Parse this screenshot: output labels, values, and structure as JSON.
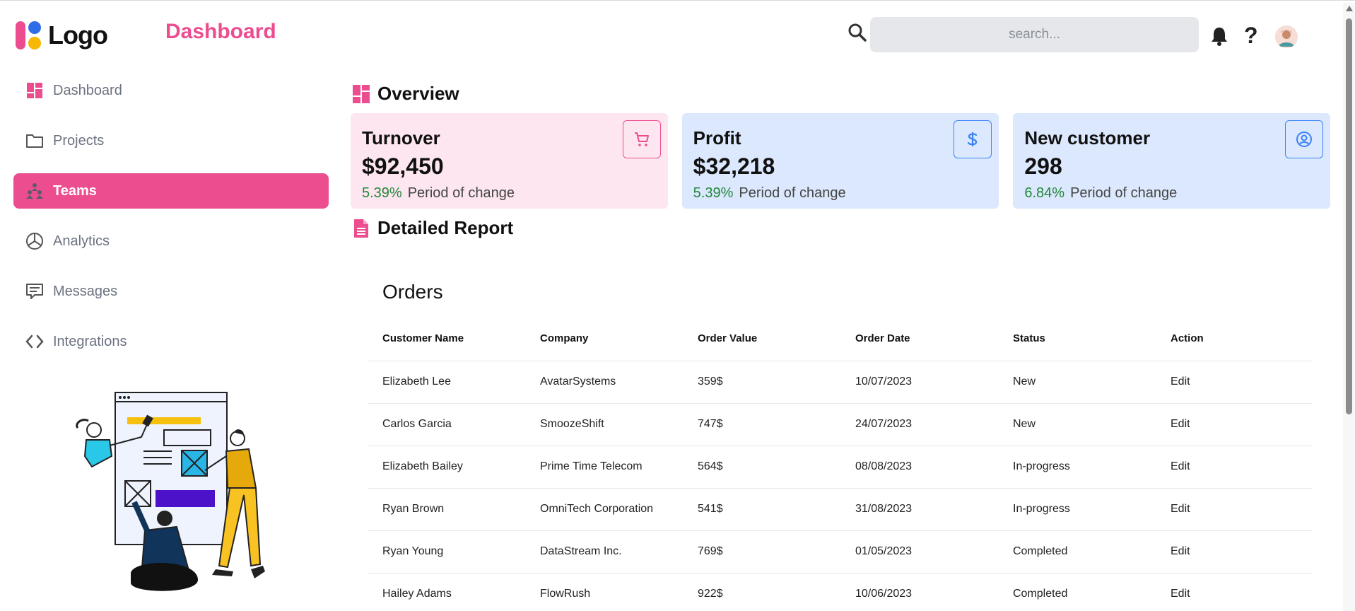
{
  "header": {
    "logo_text": "Logo",
    "page_title": "Dashboard",
    "search_placeholder": "search...",
    "help_label": "?"
  },
  "sidebar": {
    "items": [
      {
        "label": "Dashboard",
        "icon": "dashboard-grid-icon",
        "active": false
      },
      {
        "label": "Projects",
        "icon": "folder-icon",
        "active": false
      },
      {
        "label": "Teams",
        "icon": "team-icon",
        "active": true
      },
      {
        "label": "Analytics",
        "icon": "pie-chart-icon",
        "active": false
      },
      {
        "label": "Messages",
        "icon": "message-icon",
        "active": false
      },
      {
        "label": "Integrations",
        "icon": "code-icon",
        "active": false
      }
    ]
  },
  "overview": {
    "title": "Overview",
    "cards": [
      {
        "title": "Turnover",
        "value": "$92,450",
        "change": "5.39%",
        "change_label": "Period of change",
        "icon": "cart-icon"
      },
      {
        "title": "Profit",
        "value": "$32,218",
        "change": "5.39%",
        "change_label": "Period of change",
        "icon": "dollar-icon"
      },
      {
        "title": "New customer",
        "value": "298",
        "change": "6.84%",
        "change_label": "Period of change",
        "icon": "user-circle-icon"
      }
    ]
  },
  "report": {
    "title": "Detailed Report",
    "orders_title": "Orders",
    "columns": [
      "Customer Name",
      "Company",
      "Order Value",
      "Order Date",
      "Status",
      "Action"
    ],
    "rows": [
      [
        "Elizabeth Lee",
        "AvatarSystems",
        "359$",
        "10/07/2023",
        "New",
        "Edit"
      ],
      [
        "Carlos Garcia",
        "SmoozeShift",
        "747$",
        "24/07/2023",
        "New",
        "Edit"
      ],
      [
        "Elizabeth Bailey",
        "Prime Time Telecom",
        "564$",
        "08/08/2023",
        "In-progress",
        "Edit"
      ],
      [
        "Ryan Brown",
        "OmniTech Corporation",
        "541$",
        "31/08/2023",
        "In-progress",
        "Edit"
      ],
      [
        "Ryan Young",
        "DataStream Inc.",
        "769$",
        "01/05/2023",
        "Completed",
        "Edit"
      ],
      [
        "Hailey Adams",
        "FlowRush",
        "922$",
        "10/06/2023",
        "Completed",
        "Edit"
      ]
    ]
  },
  "colors": {
    "brand": "#ec4d8f",
    "accent_blue": "#3b82f6",
    "positive": "#22863a"
  }
}
